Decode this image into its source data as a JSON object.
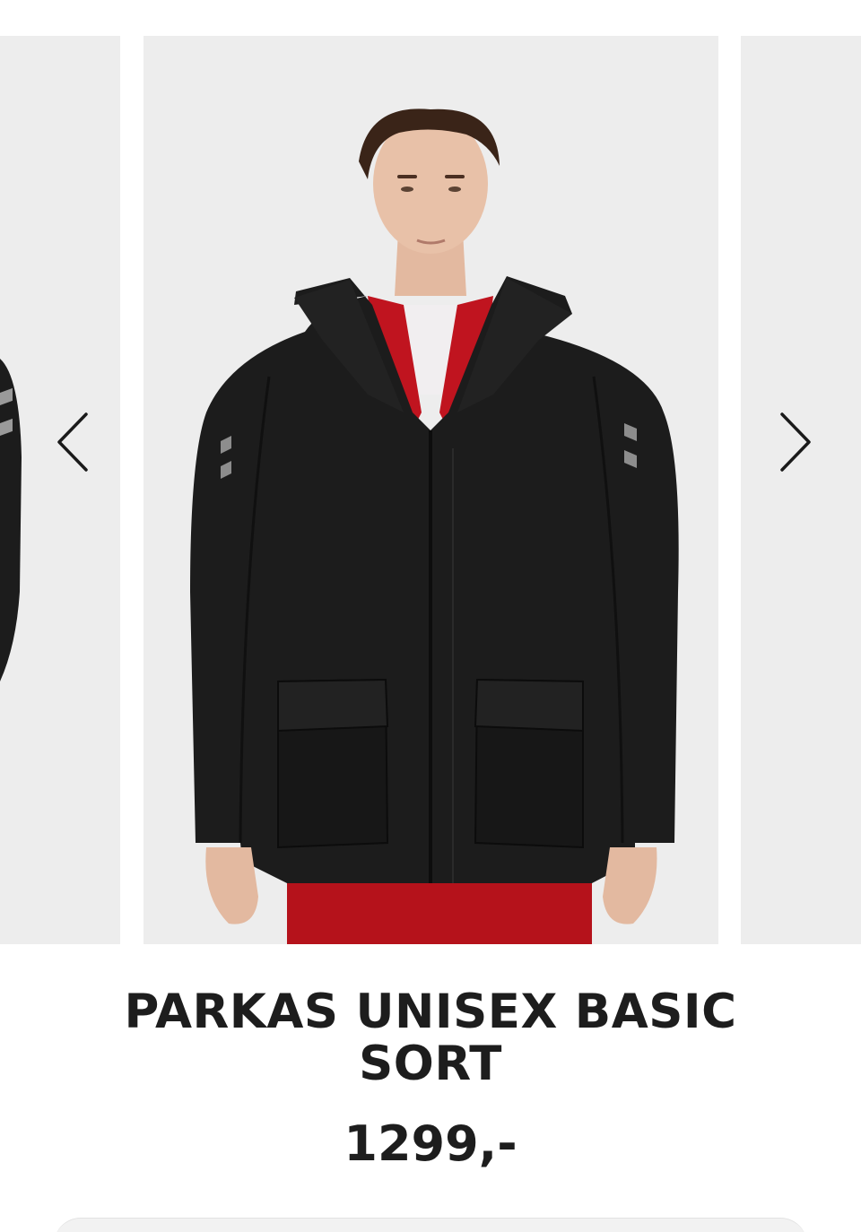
{
  "product": {
    "title": "PARKAS UNISEX BASIC SORT",
    "price": "1299,-"
  },
  "carousel": {
    "prev_icon": "chevron-left-icon",
    "next_icon": "chevron-right-icon",
    "slide_background": "#ededed"
  },
  "colors": {
    "jacket": "#1c1c1c",
    "accent_red": "#b5121b",
    "text": "#1d1d1d"
  }
}
